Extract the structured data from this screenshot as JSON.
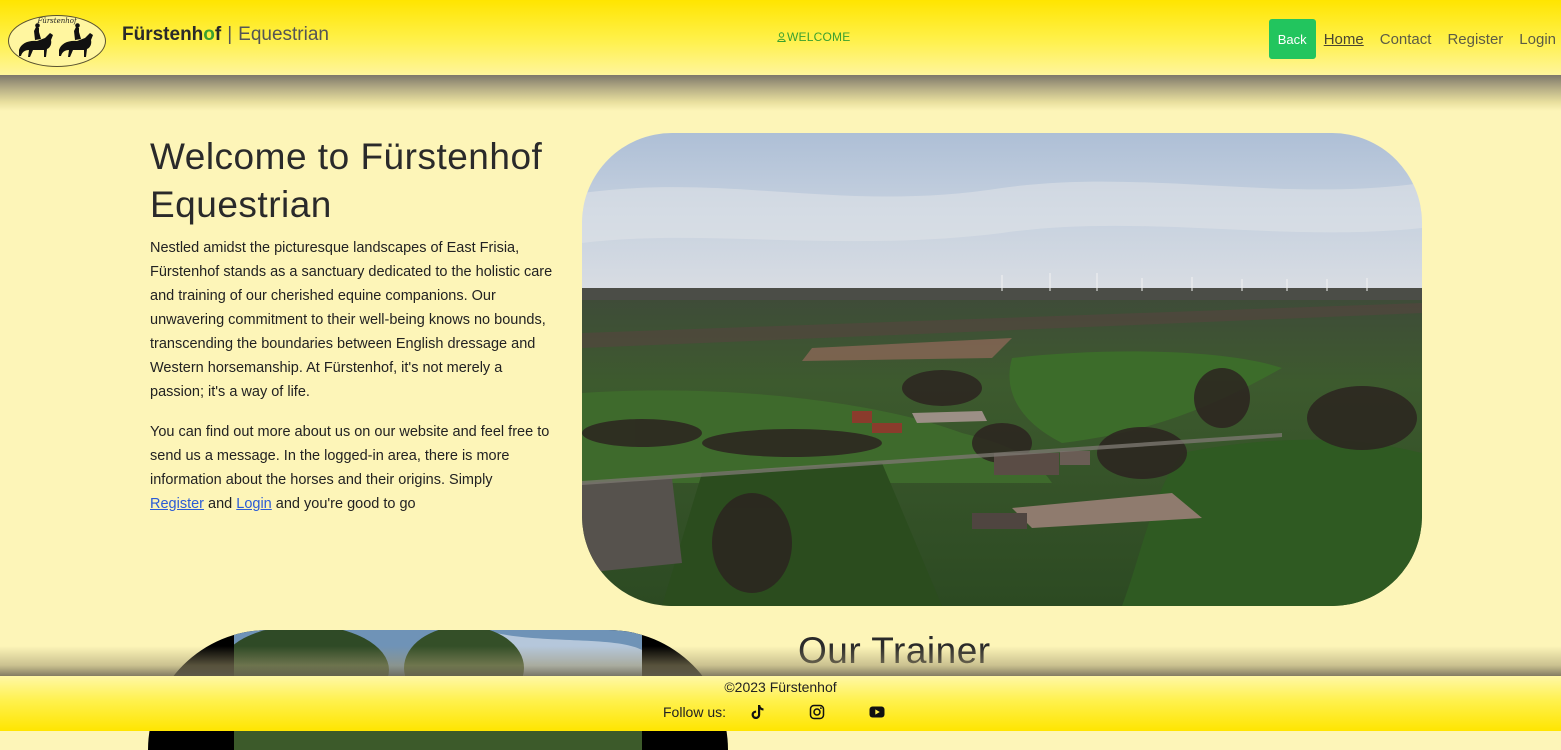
{
  "header": {
    "logo_text": "Fürstenhof",
    "brand_bold_start": "Fürstenh",
    "brand_bold_accent": "o",
    "brand_bold_end": "f",
    "brand_separator": "|",
    "brand_sub": "Equestrian",
    "welcome": "WELCOME",
    "welcome_icon": "user-icon",
    "back_label": "Back",
    "nav": [
      {
        "label": "Home",
        "active": true
      },
      {
        "label": "Contact",
        "active": false
      },
      {
        "label": "Register",
        "active": false
      },
      {
        "label": "Login",
        "active": false
      }
    ]
  },
  "hero": {
    "title": "Welcome to Fürstenhof Equestrian",
    "paragraph1": "Nestled amidst the picturesque landscapes of East Frisia, Fürstenhof stands as a sanctuary dedicated to the holistic care and training of our cherished equine companions. Our unwavering commitment to their well-being knows no bounds, transcending the boundaries between English dressage and Western horsemanship. At Fürstenhof, it's not merely a passion; it's a way of life.",
    "paragraph2_start": "You can find out more about us on our website and feel free to send us a message. In the logged-in area, there is more information about the horses and their origins. Simply",
    "register_link": "Register",
    "and_text": "and",
    "login_link": "Login",
    "paragraph2_end": "and you're good to go"
  },
  "trainer": {
    "title": "Our Trainer"
  },
  "footer": {
    "copyright": "©2023 Fürstenhof",
    "follow_label": "Follow us:",
    "social_icons": [
      "tiktok-icon",
      "instagram-icon",
      "youtube-icon"
    ]
  },
  "colors": {
    "header_yellow": "#ffe500",
    "page_background": "#fdf5b8",
    "back_button": "#22c55e",
    "welcome_green": "#3ba02f",
    "brand_accent": "#3ba02f",
    "link_blue": "#2b5bd6"
  }
}
